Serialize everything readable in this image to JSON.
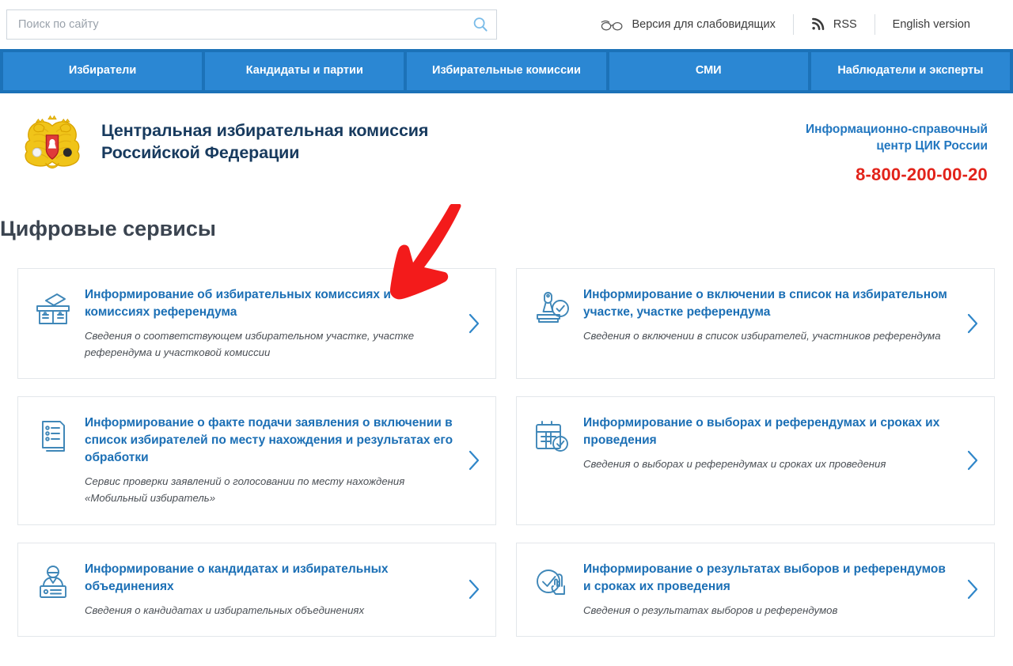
{
  "topbar": {
    "search": {
      "placeholder": "Поиск по сайту",
      "value": "",
      "icon": "search-icon"
    },
    "accessibility": {
      "label": "Версия для слабовидящих",
      "icon": "glasses-icon"
    },
    "rss": {
      "label": "RSS",
      "icon": "rss-icon"
    },
    "english": {
      "label": "English version"
    }
  },
  "nav": {
    "items": [
      {
        "label": "Избиратели"
      },
      {
        "label": "Кандидаты и партии"
      },
      {
        "label": "Избирательные комиссии"
      },
      {
        "label": "СМИ"
      },
      {
        "label": "Наблюдатели и эксперты"
      }
    ]
  },
  "masthead": {
    "emblem_icon": "russian-coat-of-arms-icon",
    "title_line1": "Центральная избирательная комиссия",
    "title_line2": "Российской Федерации",
    "contact_line1": "Информационно-справочный",
    "contact_line2": "центр ЦИК России",
    "phone": "8-800-200-00-20"
  },
  "section": {
    "title": "Цифровые сервисы"
  },
  "annotation": {
    "arrow": "red-down-left-arrow",
    "color": "#f31b1b"
  },
  "colors": {
    "nav_bar_bg": "#1c72b8",
    "nav_item_bg": "#2b87d3",
    "card_title_blue": "#1b6fb5",
    "icon_blue": "#3f87b8",
    "phone_red": "#e2231a",
    "contact_blue": "#2277c0",
    "brand_navy": "#173a5e",
    "section_title_gray": "#3b4450"
  },
  "services": [
    {
      "icon": "ballot-box-icon",
      "title": "Информирование об избирательных комиссиях и комиссиях референдума",
      "desc": "Сведения о соответствующем избирательном участке, участке референдума и участковой комиссии",
      "chevron": "chevron-right-icon"
    },
    {
      "icon": "stamp-check-icon",
      "title": "Информирование о включении в список на избирательном участке, участке референдума",
      "desc": "Сведения о включении в список избирателей, участников референдума",
      "chevron": "chevron-right-icon"
    },
    {
      "icon": "documents-list-icon",
      "title": "Информирование о факте подачи заявления о включении в список избирателей по месту нахождения и результатах его обработки",
      "desc": "Сервис проверки заявлений о голосовании по месту нахождения «Мобильный избиратель»",
      "chevron": "chevron-right-icon"
    },
    {
      "icon": "calendar-check-icon",
      "title": "Информирование о выборах и референдумах и сроках их проведения",
      "desc": "Сведения о выборах и референдумах и сроках их проведения",
      "chevron": "chevron-right-icon"
    },
    {
      "icon": "person-id-card-icon",
      "title": "Информирование о кандидатах и избирательных объединениях",
      "desc": "Сведения о кандидатах и избирательных объединениях",
      "chevron": "chevron-right-icon"
    },
    {
      "icon": "check-hand-icon",
      "title": "Информирование о результатах выборов и референдумов и сроках их проведения",
      "desc": "Сведения о результатах выборов и референдумов",
      "chevron": "chevron-right-icon"
    }
  ]
}
